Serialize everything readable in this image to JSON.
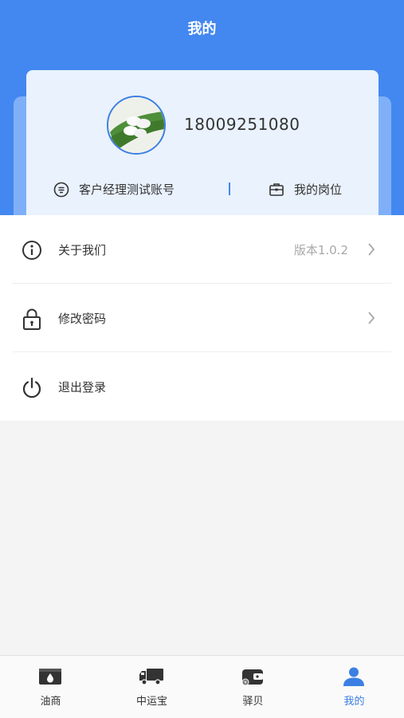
{
  "header": {
    "title": "我的"
  },
  "profile": {
    "phone": "18009251080",
    "account": "客户经理测试账号",
    "post_label": "我的岗位"
  },
  "menu": [
    {
      "label": "关于我们",
      "value": "版本1.0.2",
      "icon": "info-icon"
    },
    {
      "label": "修改密码",
      "icon": "lock-icon"
    },
    {
      "label": "退出登录",
      "icon": "power-icon"
    }
  ],
  "tabbar": {
    "active": "我的",
    "items": [
      {
        "label": "油商",
        "icon": "oil-box-icon"
      },
      {
        "label": "中运宝",
        "icon": "truck-icon"
      },
      {
        "label": "驿贝",
        "icon": "wallet-icon"
      },
      {
        "label": "我的",
        "icon": "user-icon"
      }
    ]
  },
  "colors": {
    "brand": "#4387f0",
    "active_tab": "#3c7fe3",
    "muted": "#a8a8a8"
  }
}
